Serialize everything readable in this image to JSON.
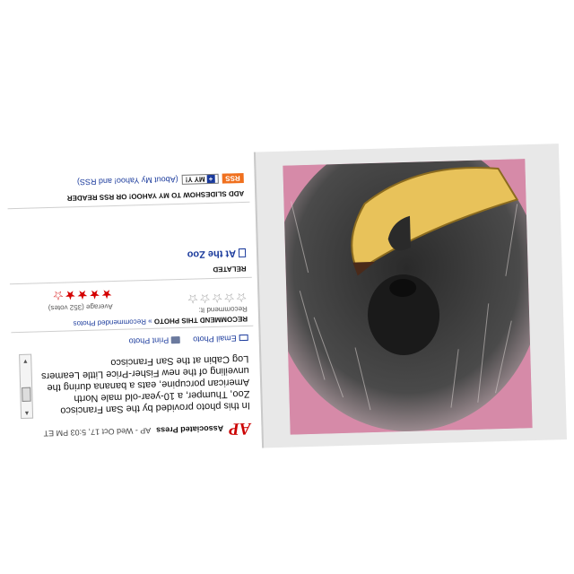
{
  "byline": {
    "logo": "AP",
    "source": "Associated Press",
    "meta": "AP - Wed Oct 17, 5:03 PM ET"
  },
  "photo": {
    "description": "Porcupine eating a banana",
    "icon": "porcupine-photo"
  },
  "caption": "In this photo provided by the San Francisco Zoo, Thumper, a 10-year-old male North American porcupine, eats a banana during the unveiling of the new Fisher-Price Little Leamers Log Cabin at the San Francisco",
  "actions": {
    "email": "Email Photo",
    "print": "Print Photo"
  },
  "recommend": {
    "title": "RECOMMEND THIS PHOTO",
    "link": "» Recommended Photos",
    "sub": "Recommend It:",
    "user_stars": "☆☆☆☆☆",
    "avg_label": "Average (352 votes)",
    "avg_stars": "★★★★☆",
    "rating": 4
  },
  "related": {
    "title": "RELATED",
    "link": "At the Zoo"
  },
  "add": {
    "title": "ADD SLIDESHOW TO MY YAHOO! OR RSS READER",
    "rss": "RSS",
    "myyahoo_plus": "+",
    "myyahoo": "MY Y!",
    "about": "(About My Yahoo! and RSS)"
  },
  "colors": {
    "accent": "#cc0000",
    "link": "#1a3a9c",
    "rss": "#f0701e"
  }
}
